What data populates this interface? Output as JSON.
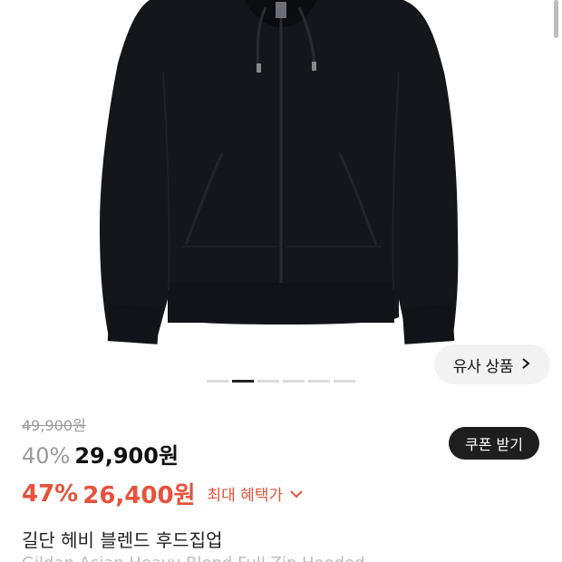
{
  "product": {
    "original_price": "49,900원",
    "discount_percent": "40%",
    "discount_price": "29,900원",
    "benefit_percent": "47%",
    "benefit_price": "26,400원",
    "max_benefit_label": "최대 혜택가",
    "title_ko": "길단 헤비 블렌드 후드집업",
    "title_en": "Gildan Asian Heavy Blend Full Zip Hooded"
  },
  "buttons": {
    "similar_products": "유사 상품",
    "coupon": "쿠폰 받기"
  },
  "gallery": {
    "total_dots": 6,
    "active_index": 1
  },
  "colors": {
    "accent_red": "#e8513a",
    "hoodie": "#15161c"
  },
  "icons": {
    "similar_chevron": "chevron-right-icon",
    "benefit_chevron": "chevron-down-icon"
  }
}
